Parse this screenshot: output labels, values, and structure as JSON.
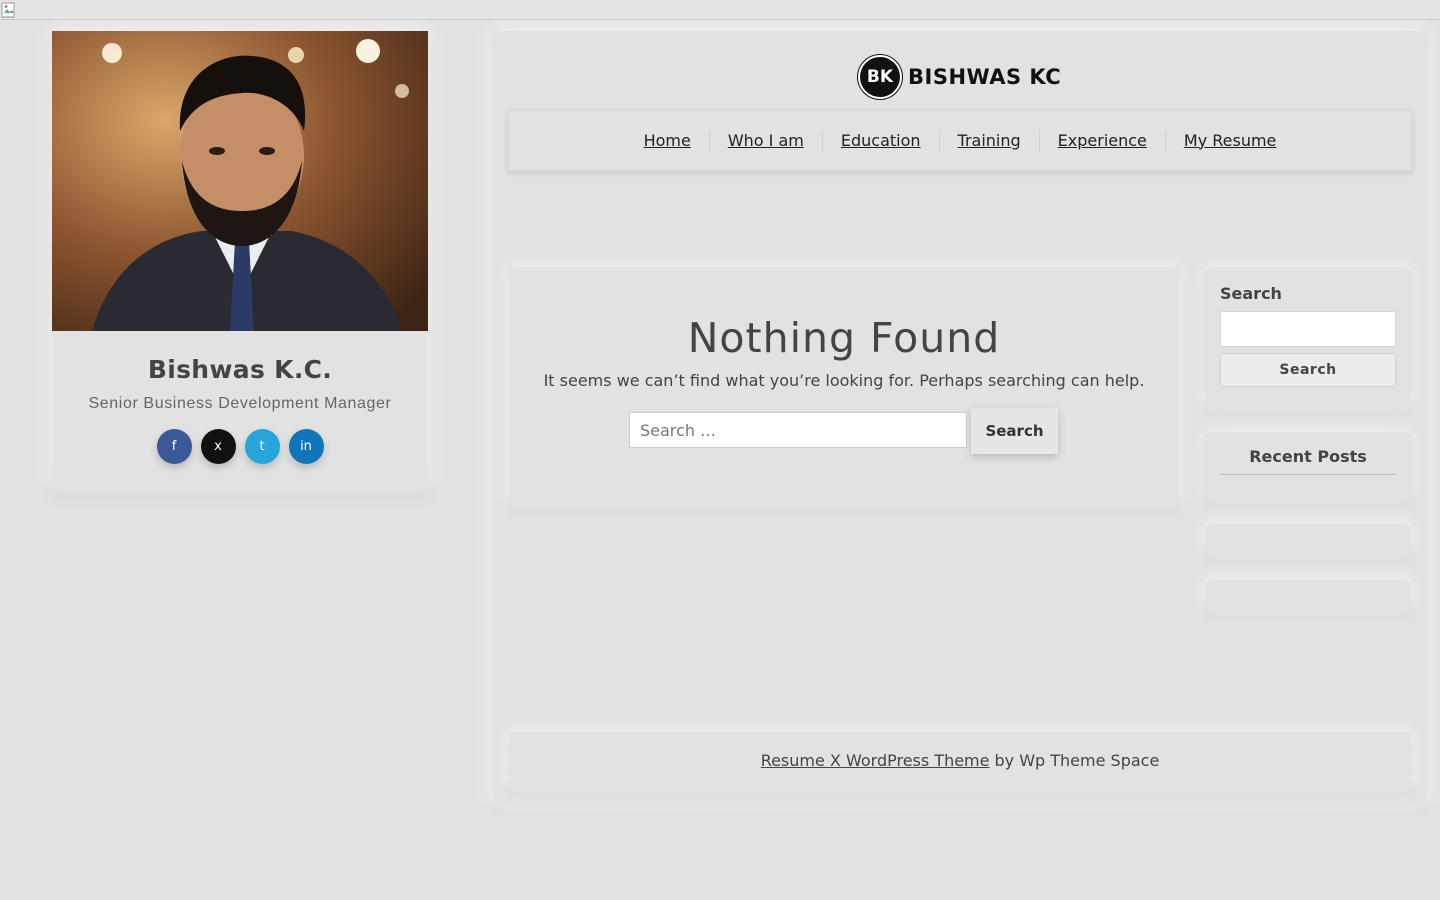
{
  "profile": {
    "name": "Bishwas K.C.",
    "role": "Senior Business Development Manager",
    "social": [
      {
        "icon": "facebook-icon",
        "color": "#3b5998",
        "glyph": "f"
      },
      {
        "icon": "x-twitter-icon",
        "color": "#111111",
        "glyph": "x"
      },
      {
        "icon": "twitter-icon",
        "color": "#1da1f2",
        "glyph": "t"
      },
      {
        "icon": "linkedin-icon",
        "color": "#0a66c2",
        "glyph": "in"
      }
    ]
  },
  "header": {
    "logo_letters": "BK",
    "site_title": "BISHWAS KC"
  },
  "nav": {
    "items": [
      "Home",
      "Who I am",
      "Education",
      "Training",
      "Experience",
      "My Resume"
    ]
  },
  "main": {
    "title": "Nothing Found",
    "message": "It seems we can’t find what you’re looking for. Perhaps searching can help.",
    "search_placeholder": "Search …",
    "search_button": "Search"
  },
  "sidebar": {
    "search_title": "Search",
    "search_button": "Search",
    "recent_posts_title": "Recent Posts"
  },
  "footer": {
    "theme_link": "Resume X WordPress Theme",
    "by_text": "by Wp Theme Space"
  }
}
